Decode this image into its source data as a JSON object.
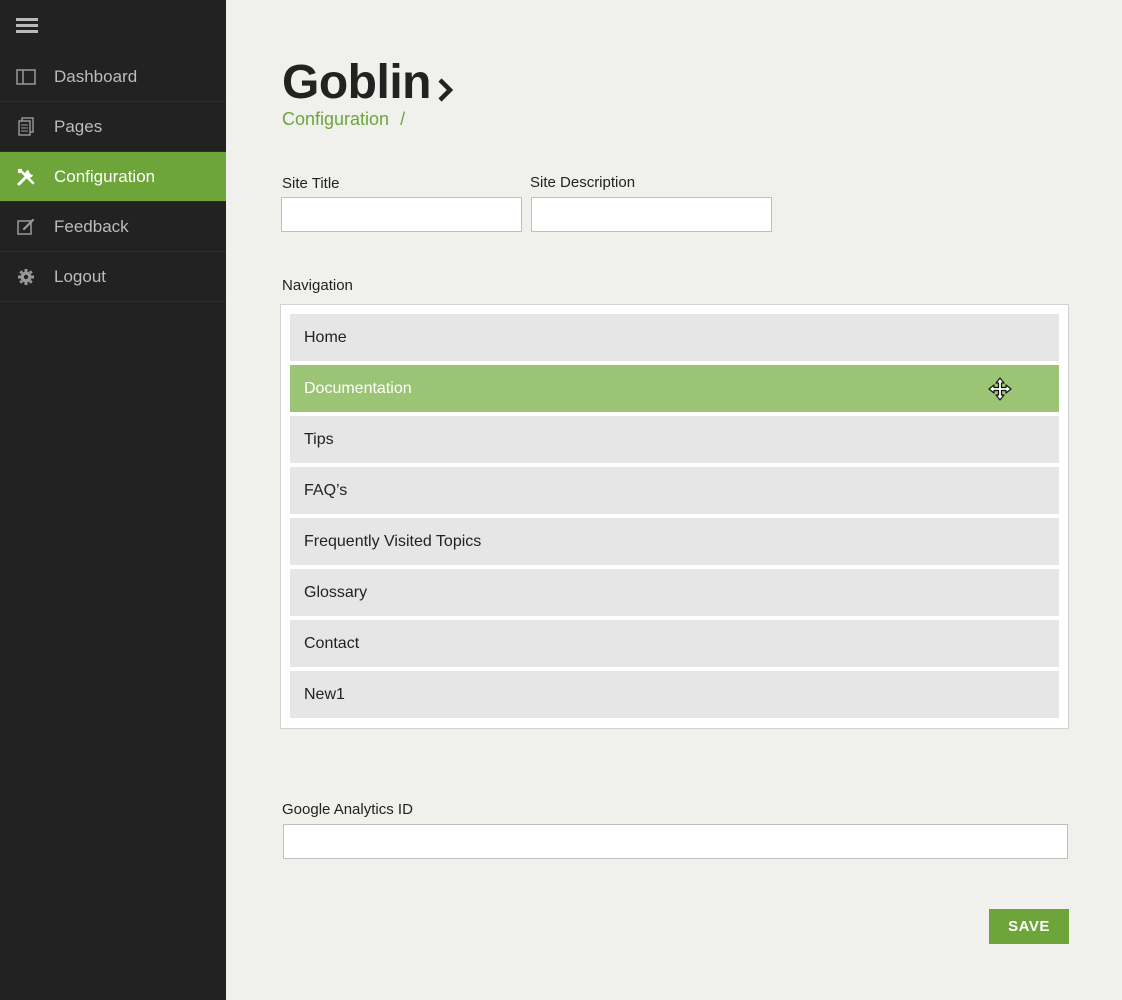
{
  "sidebar": {
    "menu_icon": "hamburger-icon",
    "items": [
      {
        "label": "Dashboard",
        "icon": "dashboard-icon",
        "active": false
      },
      {
        "label": "Pages",
        "icon": "pages-icon",
        "active": false
      },
      {
        "label": "Configuration",
        "icon": "tools-icon",
        "active": true
      },
      {
        "label": "Feedback",
        "icon": "edit-icon",
        "active": false
      },
      {
        "label": "Logout",
        "icon": "gear-icon",
        "active": false
      }
    ]
  },
  "header": {
    "title": "Goblin",
    "breadcrumb": "Configuration",
    "breadcrumb_separator": "/"
  },
  "form": {
    "site_title_label": "Site Title",
    "site_title_value": "",
    "site_description_label": "Site Description",
    "site_description_value": "",
    "navigation_label": "Navigation",
    "navigation_items": [
      "Home",
      "Documentation",
      "Tips",
      "FAQ’s",
      "Frequently Visited Topics",
      "Glossary",
      "Contact",
      "New1"
    ],
    "dragging_item": "Documentation",
    "analytics_label": "Google Analytics ID",
    "analytics_value": "",
    "save_label": "SAVE"
  },
  "colors": {
    "sidebar_bg": "#222222",
    "accent": "#6da53a",
    "drag_highlight": "#9bc574",
    "page_bg": "#f0f1ec"
  }
}
